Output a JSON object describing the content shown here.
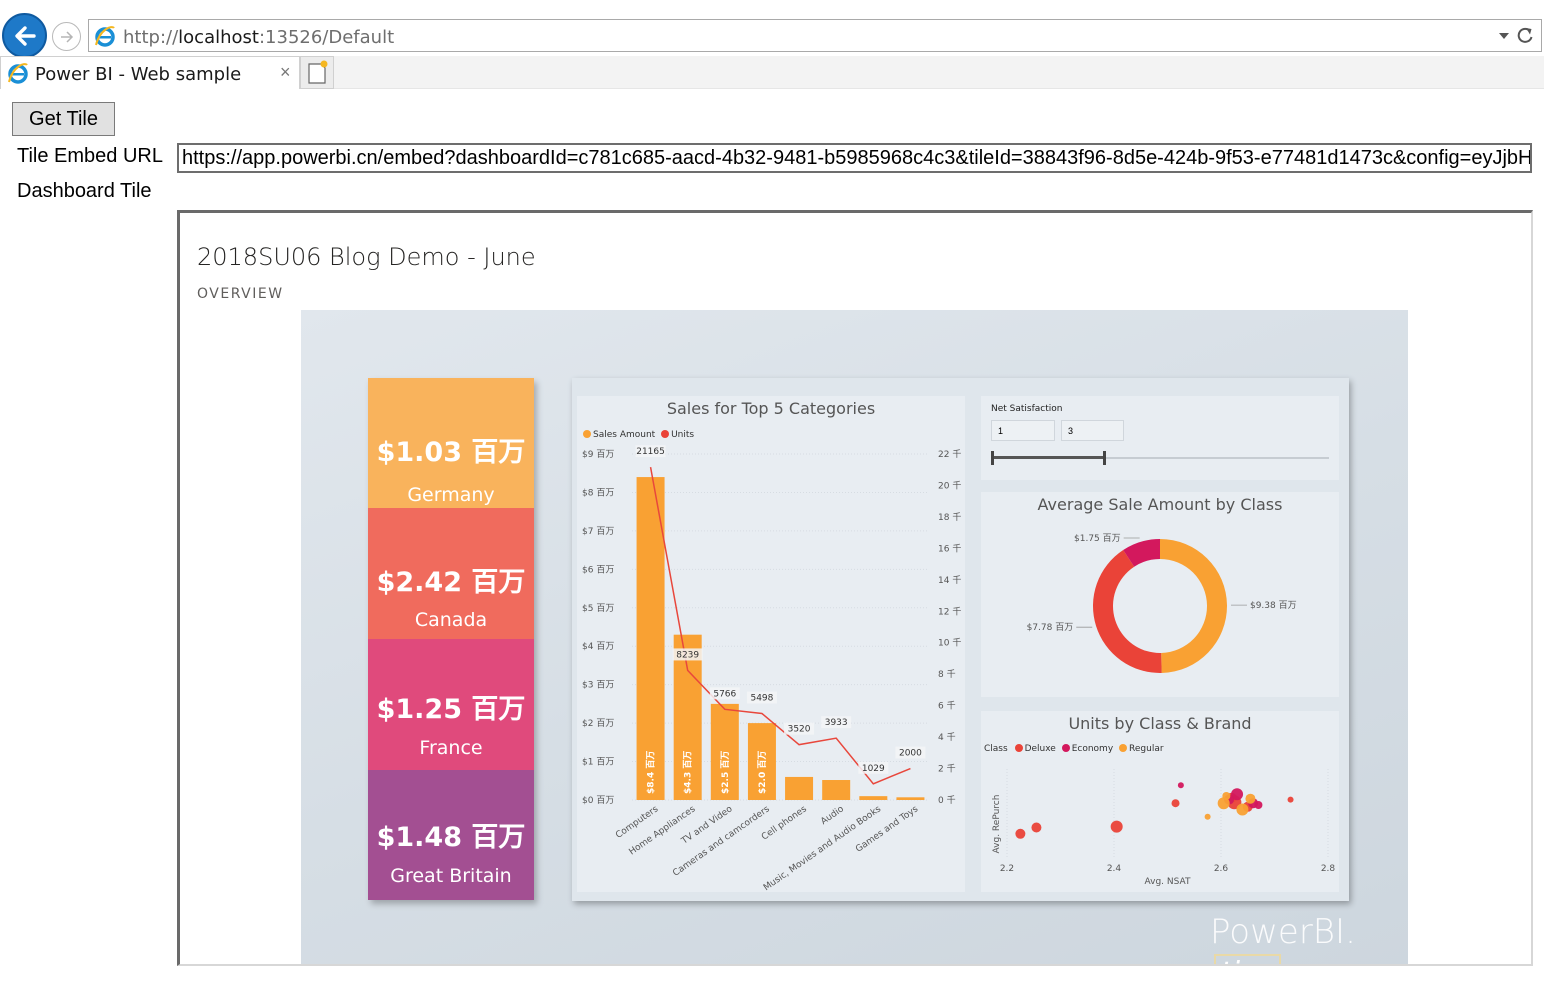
{
  "browser": {
    "url_prefix": "http://",
    "url_host": "localhost",
    "url_rest": ":13526/Default",
    "tab_title": "Power BI - Web sample",
    "tab_close": "×"
  },
  "page": {
    "get_tile_button": "Get Tile",
    "embed_url_label": "Tile Embed URL",
    "embed_url_value": "https://app.powerbi.cn/embed?dashboardId=c781c685-aacd-4b32-9481-b5985968c4c3&tileId=38843f96-8d5e-424b-9f53-e77481d1473c&config=eyJjbH",
    "dashboard_tile_label": "Dashboard Tile"
  },
  "tile": {
    "title": "2018SU06 Blog Demo - June",
    "subtitle": "OVERVIEW"
  },
  "kpis": [
    {
      "value": "$1.03 百万",
      "country": "Germany",
      "color": "#f9b35c"
    },
    {
      "value": "$2.42 百万",
      "country": "Canada",
      "color": "#f06b5d"
    },
    {
      "value": "$1.25 百万",
      "country": "France",
      "color": "#e04a7c"
    },
    {
      "value": "$1.48 百万",
      "country": "Great Britain",
      "color": "#a34f92"
    }
  ],
  "slicer": {
    "title": "Net Satisfaction",
    "min": "1",
    "max": "3",
    "range_fraction": 0.33
  },
  "watermark": {
    "brand": "PowerBI.",
    "tips": "tips"
  },
  "colors": {
    "orange": "#f9a133",
    "red": "#ea4338",
    "magenta": "#d3185d",
    "line": "#e8473c"
  },
  "chart_data": [
    {
      "type": "bar",
      "title": "Sales for Top 5 Categories",
      "legend": [
        "Sales Amount",
        "Units"
      ],
      "categories": [
        "Computers",
        "Home Appliances",
        "TV and Video",
        "Cameras and camcorders",
        "Cell phones",
        "Audio",
        "Music, Movies and Audio Books",
        "Games and Toys"
      ],
      "series": [
        {
          "name": "Sales Amount",
          "axis": "left",
          "values": [
            8.4,
            4.3,
            2.5,
            2.0,
            0.6,
            0.52,
            0.1,
            0.07
          ],
          "bar_labels": [
            "$8.4 百万",
            "$4.3 百万",
            "$2.5 百万",
            "$2.0 百万",
            "",
            "",
            "",
            ""
          ]
        },
        {
          "name": "Units",
          "axis": "right",
          "type": "line",
          "values": [
            21165,
            8239,
            5766,
            5498,
            3520,
            3933,
            1029,
            2000
          ]
        }
      ],
      "y_left_ticks": [
        "$9 百万",
        "$8 百万",
        "$7 百万",
        "$6 百万",
        "$5 百万",
        "$4 百万",
        "$3 百万",
        "$2 百万",
        "$1 百万",
        "$0 百万"
      ],
      "y_right_ticks": [
        "22 千",
        "20 千",
        "18 千",
        "16 千",
        "14 千",
        "12 千",
        "10 千",
        "8 千",
        "6 千",
        "4 千",
        "2 千",
        "0 千"
      ],
      "ylim_left": [
        0,
        9
      ],
      "ylim_right": [
        0,
        22000
      ]
    },
    {
      "type": "pie",
      "title": "Average Sale Amount by Class",
      "donut": true,
      "labels": [
        "Regular",
        "Deluxe",
        "Economy"
      ],
      "values": [
        9.38,
        7.78,
        1.75
      ],
      "data_labels": [
        "$9.38 百万",
        "$7.78 百万",
        "$1.75 百万"
      ],
      "colors": [
        "#f9a133",
        "#ea4338",
        "#d3185d"
      ]
    },
    {
      "type": "scatter",
      "title": "Units by Class & Brand",
      "legend_title": "Class",
      "legend": [
        "Deluxe",
        "Economy",
        "Regular"
      ],
      "xlabel": "Avg. NSAT",
      "ylabel": "Avg. RePurch",
      "x_ticks": [
        "2.2",
        "2.4",
        "2.6",
        "2.8"
      ],
      "xlim": [
        2.2,
        2.8
      ],
      "ylim": [
        0,
        1
      ],
      "series": [
        {
          "name": "Deluxe",
          "points": [
            [
              2.225,
              0.28,
              5
            ],
            [
              2.255,
              0.35,
              5
            ],
            [
              2.405,
              0.36,
              6
            ],
            [
              2.515,
              0.62,
              4
            ],
            [
              2.73,
              0.66,
              3
            ],
            [
              2.62,
              0.68,
              5
            ],
            [
              2.65,
              0.58,
              5
            ],
            [
              2.625,
              0.63,
              7
            ]
          ]
        },
        {
          "name": "Economy",
          "points": [
            [
              2.525,
              0.82,
              3
            ],
            [
              2.63,
              0.72,
              6
            ],
            [
              2.66,
              0.62,
              5
            ],
            [
              2.67,
              0.6,
              4
            ],
            [
              2.615,
              0.66,
              5
            ]
          ]
        },
        {
          "name": "Regular",
          "points": [
            [
              2.575,
              0.47,
              3
            ],
            [
              2.605,
              0.62,
              6
            ],
            [
              2.64,
              0.55,
              6
            ],
            [
              2.655,
              0.67,
              5
            ],
            [
              2.61,
              0.7,
              4
            ]
          ]
        }
      ]
    }
  ]
}
